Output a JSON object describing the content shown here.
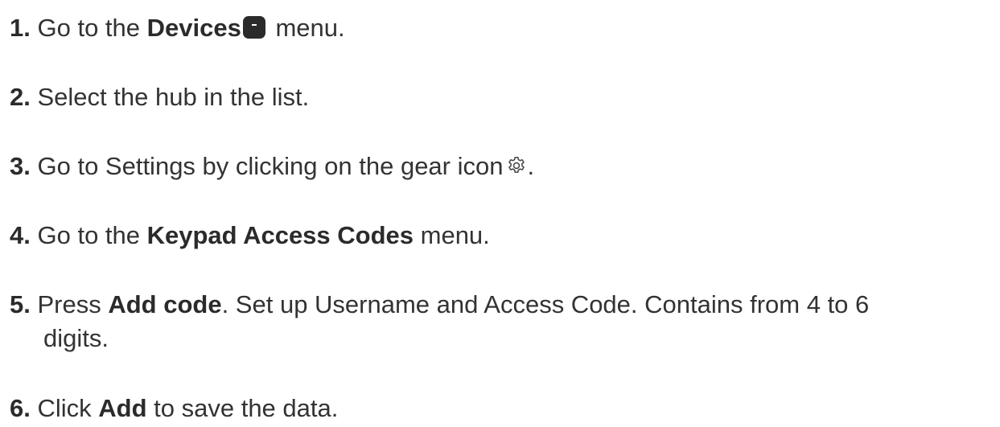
{
  "steps": [
    {
      "num": "1.",
      "pre": "Go to the ",
      "bold": "Devices",
      "post": " menu."
    },
    {
      "num": "2.",
      "text": "Select the hub in the list."
    },
    {
      "num": "3.",
      "pre": "Go to Settings by clicking on the gear icon",
      "post": "."
    },
    {
      "num": "4.",
      "pre": "Go to the ",
      "bold": "Keypad Access Codes",
      "post": " menu."
    },
    {
      "num": "5.",
      "pre": "Press ",
      "bold": "Add code",
      "post": ". Set up Username and Access Code. Contains from 4 to 6",
      "cont": "digits."
    },
    {
      "num": "6.",
      "pre": "Click ",
      "bold": "Add",
      "post": " to save the data."
    }
  ],
  "icons": {
    "devices": "devices-icon",
    "gear": "gear-icon"
  }
}
